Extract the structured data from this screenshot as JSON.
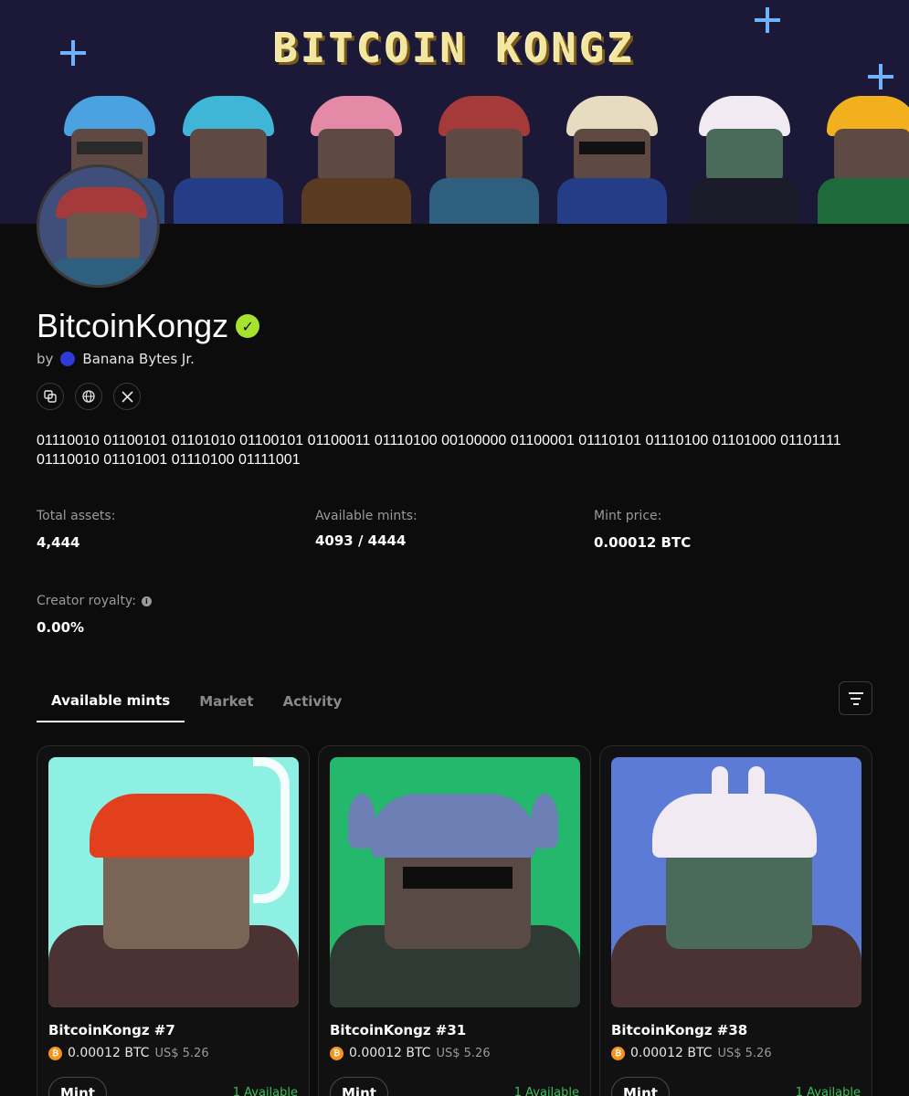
{
  "banner": {
    "title": "BITCOIN KONGZ"
  },
  "collection": {
    "name": "BitcoinKongz",
    "by_label": "by",
    "creator": "Banana Bytes Jr.",
    "description": "01110010 01100101 01101010 01100101 01100011 01110100 00100000 01100001 01110101 01110100 01101000 01101111 01110010 01101001 01110100 01111001"
  },
  "stats": {
    "total_assets_label": "Total assets:",
    "total_assets": "4,444",
    "available_mints_label": "Available mints:",
    "available_mints": "4093 / 4444",
    "mint_price_label": "Mint price:",
    "mint_price": "0.00012 BTC",
    "creator_royalty_label": "Creator royalty:",
    "creator_royalty": "0.00%"
  },
  "tabs": [
    {
      "label": "Available mints",
      "active": true
    },
    {
      "label": "Market",
      "active": false
    },
    {
      "label": "Activity",
      "active": false
    }
  ],
  "cards": [
    {
      "name": "BitcoinKongz #7",
      "price": "0.00012 BTC",
      "usd": "US$ 5.26",
      "button": "Mint",
      "availability": "1 Available",
      "bg": "#8ef0e2"
    },
    {
      "name": "BitcoinKongz #31",
      "price": "0.00012 BTC",
      "usd": "US$ 5.26",
      "button": "Mint",
      "availability": "1 Available",
      "bg": "#23b86b"
    },
    {
      "name": "BitcoinKongz #38",
      "price": "0.00012 BTC",
      "usd": "US$ 5.26",
      "button": "Mint",
      "availability": "1 Available",
      "bg": "#5b7bd6"
    }
  ],
  "colors": {
    "accent_verified": "#a6e22e",
    "available_green": "#3fbf5a",
    "bitcoin_orange": "#f7931a"
  },
  "icons": {
    "verified": "check-badge-icon",
    "copy": "copy-icon",
    "website": "globe-icon",
    "x": "x-logo-icon",
    "info": "info-icon",
    "filter": "filter-icon",
    "btc": "bitcoin-icon"
  }
}
